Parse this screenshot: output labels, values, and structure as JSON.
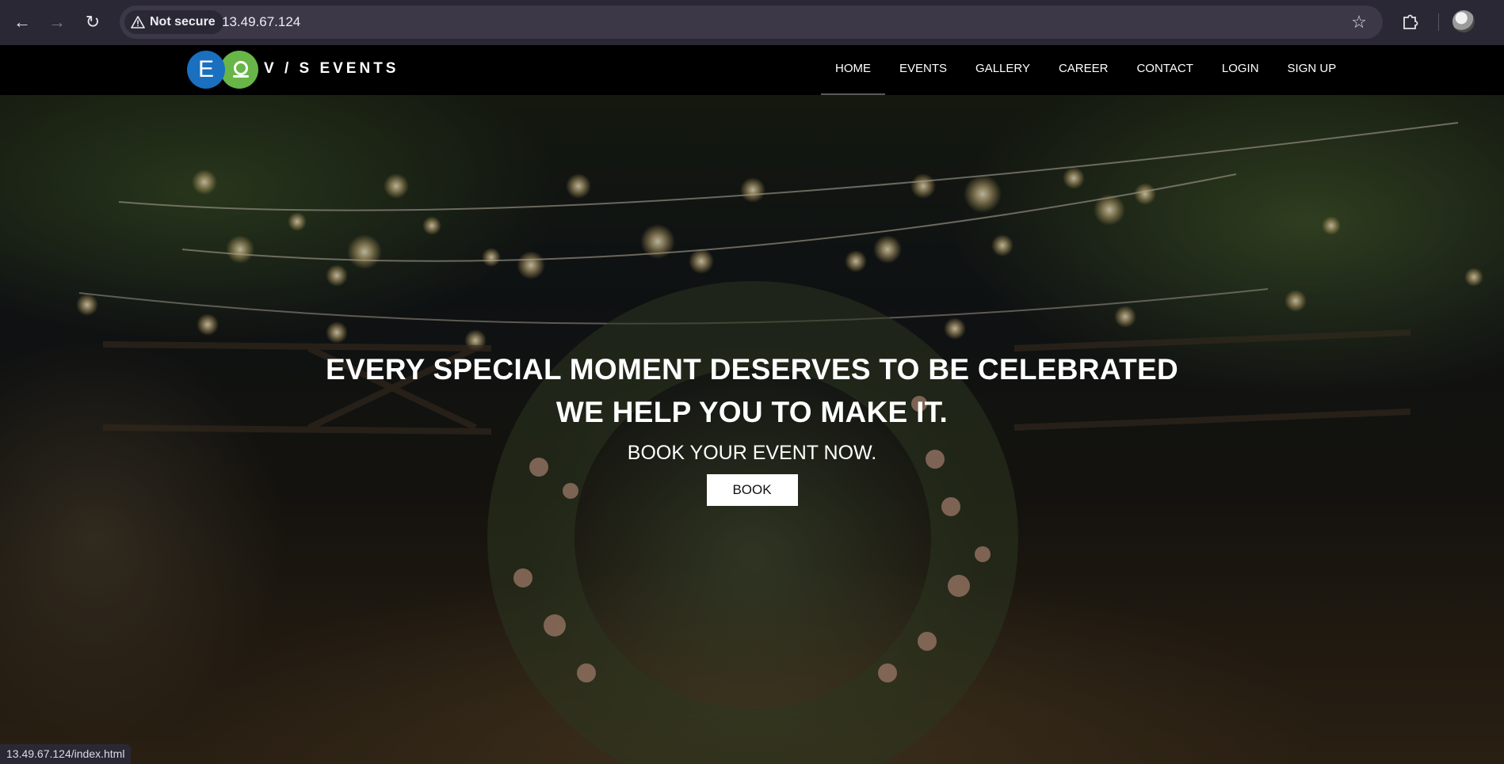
{
  "browser": {
    "security_label": "Not secure",
    "url": "13.49.67.124",
    "status_url": "13.49.67.124/index.html",
    "icons": [
      "back-icon",
      "forward-icon",
      "reload-icon",
      "warning-icon",
      "star-icon",
      "extensions-icon",
      "profile-icon"
    ]
  },
  "site": {
    "logo_letter": "E",
    "brand": "V / S EVENTS",
    "nav": [
      {
        "label": "HOME",
        "active": true
      },
      {
        "label": "EVENTS"
      },
      {
        "label": "GALLERY"
      },
      {
        "label": "CAREER"
      },
      {
        "label": "CONTACT"
      },
      {
        "label": "LOGIN"
      },
      {
        "label": "SIGN UP"
      }
    ]
  },
  "hero": {
    "heading_line1": "EVERY SPECIAL MOMENT DESERVES TO BE CELEBRATED",
    "heading_line2": "WE HELP YOU TO MAKE IT.",
    "subheading": "BOOK YOUR EVENT NOW.",
    "button_label": "BOOK"
  },
  "colors": {
    "chrome_bg": "#2b2836",
    "omnibox_bg": "#3c3848",
    "header_bg": "#000000",
    "logo_blue": "#1a6fbf",
    "logo_green": "#6ec04b",
    "button_bg": "#ffffff"
  }
}
